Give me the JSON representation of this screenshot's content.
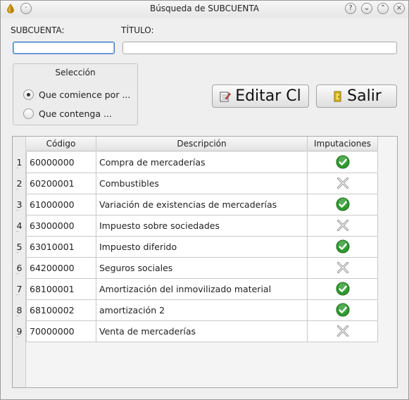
{
  "window": {
    "title": "Búsqueda de SUBCUENTA",
    "controls": [
      "help-icon",
      "minimize-icon",
      "restore-icon",
      "close-icon"
    ]
  },
  "form": {
    "subcuenta_label": "SUBCUENTA:",
    "subcuenta_value": "",
    "titulo_label": "TÍTULO:",
    "titulo_value": ""
  },
  "seleccion": {
    "title": "Selección",
    "options": [
      {
        "label": "Que comience por ...",
        "checked": true
      },
      {
        "label": "Que contenga ...",
        "checked": false
      }
    ]
  },
  "buttons": {
    "editar_label": "Editar Cl",
    "editar_icon": "edit-document-icon",
    "salir_label": "Salir",
    "salir_icon": "exit-door-icon"
  },
  "table": {
    "columns": [
      "Código",
      "Descripción",
      "Imputaciones"
    ],
    "rows": [
      {
        "num": "1",
        "codigo": "60000000",
        "descripcion": "Compra de mercaderías",
        "imputaciones": true
      },
      {
        "num": "2",
        "codigo": "60200001",
        "descripcion": "Combustibles",
        "imputaciones": false
      },
      {
        "num": "3",
        "codigo": "61000000",
        "descripcion": "Variación de existencias de mercaderías",
        "imputaciones": true
      },
      {
        "num": "4",
        "codigo": "63000000",
        "descripcion": "Impuesto sobre sociedades",
        "imputaciones": false
      },
      {
        "num": "5",
        "codigo": "63010001",
        "descripcion": "Impuesto diferido",
        "imputaciones": true
      },
      {
        "num": "6",
        "codigo": "64200000",
        "descripcion": "Seguros sociales",
        "imputaciones": false
      },
      {
        "num": "7",
        "codigo": "68100001",
        "descripcion": "Amortización del inmovilizado material",
        "imputaciones": true
      },
      {
        "num": "8",
        "codigo": "68100002",
        "descripcion": "amortización 2",
        "imputaciones": true
      },
      {
        "num": "9",
        "codigo": "70000000",
        "descripcion": "Venta de mercaderías",
        "imputaciones": false
      }
    ]
  },
  "colors": {
    "check_green": "#2e9a2e",
    "cross_gray": "#8a8a8a",
    "focus_blue": "#3b79c9"
  }
}
